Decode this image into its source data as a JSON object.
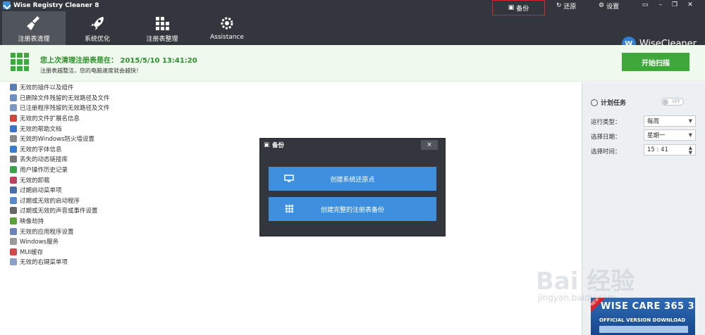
{
  "app": {
    "title": "Wise Registry Cleaner 8"
  },
  "titlebar": {
    "backup": "备份",
    "restore": "还原",
    "settings": "设置"
  },
  "toolbar": {
    "tools": [
      {
        "label": "注册表清理",
        "active": true
      },
      {
        "label": "系统优化",
        "active": false
      },
      {
        "label": "注册表整理",
        "active": false
      },
      {
        "label": "Assistance",
        "active": false
      }
    ],
    "brand": "WiseCleaner",
    "brand_badge": "W"
  },
  "banner": {
    "last_clean": "您上次清理注册表是在： 2015/5/10 13:41:20",
    "hint": "注册表越整洁，您的电脑速度就会越快！",
    "start_button": "开始扫描",
    "accent": "#3ea83a"
  },
  "list": {
    "items": [
      {
        "label": "无效的插件以及组件",
        "color": "#5b7fb5"
      },
      {
        "label": "已删除文件残留的无效路径及文件",
        "color": "#6d8fc2"
      },
      {
        "label": "已注册程序残留的无效路径及文件",
        "color": "#7c98c4"
      },
      {
        "label": "无效的文件扩展名信息",
        "color": "#d0463c"
      },
      {
        "label": "无效的帮助文档",
        "color": "#3d72c8"
      },
      {
        "label": "无效的Windows防火墙设置",
        "color": "#8a8a8a"
      },
      {
        "label": "无效的字体信息",
        "color": "#3a7bd0"
      },
      {
        "label": "丢失的动态链接库",
        "color": "#777"
      },
      {
        "label": "用户操作历史记录",
        "color": "#3aa04a"
      },
      {
        "label": "无效的卸载",
        "color": "#c04060"
      },
      {
        "label": "过期启动菜单项",
        "color": "#4a6fa8"
      },
      {
        "label": "过期或无效的启动程序",
        "color": "#5a88c8"
      },
      {
        "label": "过期或无效的声音或事件设置",
        "color": "#666"
      },
      {
        "label": "映像劫持",
        "color": "#5aa03a"
      },
      {
        "label": "无效的应用程序设置",
        "color": "#6a84b8"
      },
      {
        "label": "Windows服务",
        "color": "#9a9a9a"
      },
      {
        "label": "MUI缓存",
        "color": "#d04848"
      },
      {
        "label": "无效的右键菜单项",
        "color": "#8aa0c8"
      }
    ]
  },
  "schedule": {
    "title": "计划任务",
    "toggle": "OFF",
    "run_type_label": "运行类型：",
    "run_type_value": "每周",
    "date_label": "选择日期：",
    "date_value": "星期一",
    "time_label": "选择时间：",
    "time_value": "15 : 41"
  },
  "ad": {
    "ribbon": "NEW",
    "title": "WISE CARE 365 3",
    "subtitle": "OFFICIAL VERSION DOWNLOAD"
  },
  "modal": {
    "title": "备份",
    "close": "×",
    "btn_restore_point": "创建系统还原点",
    "btn_full_backup": "创建完整的注册表备份"
  },
  "watermark": {
    "text": "Bai 经验",
    "sub": "jingyan.baidu.com"
  }
}
